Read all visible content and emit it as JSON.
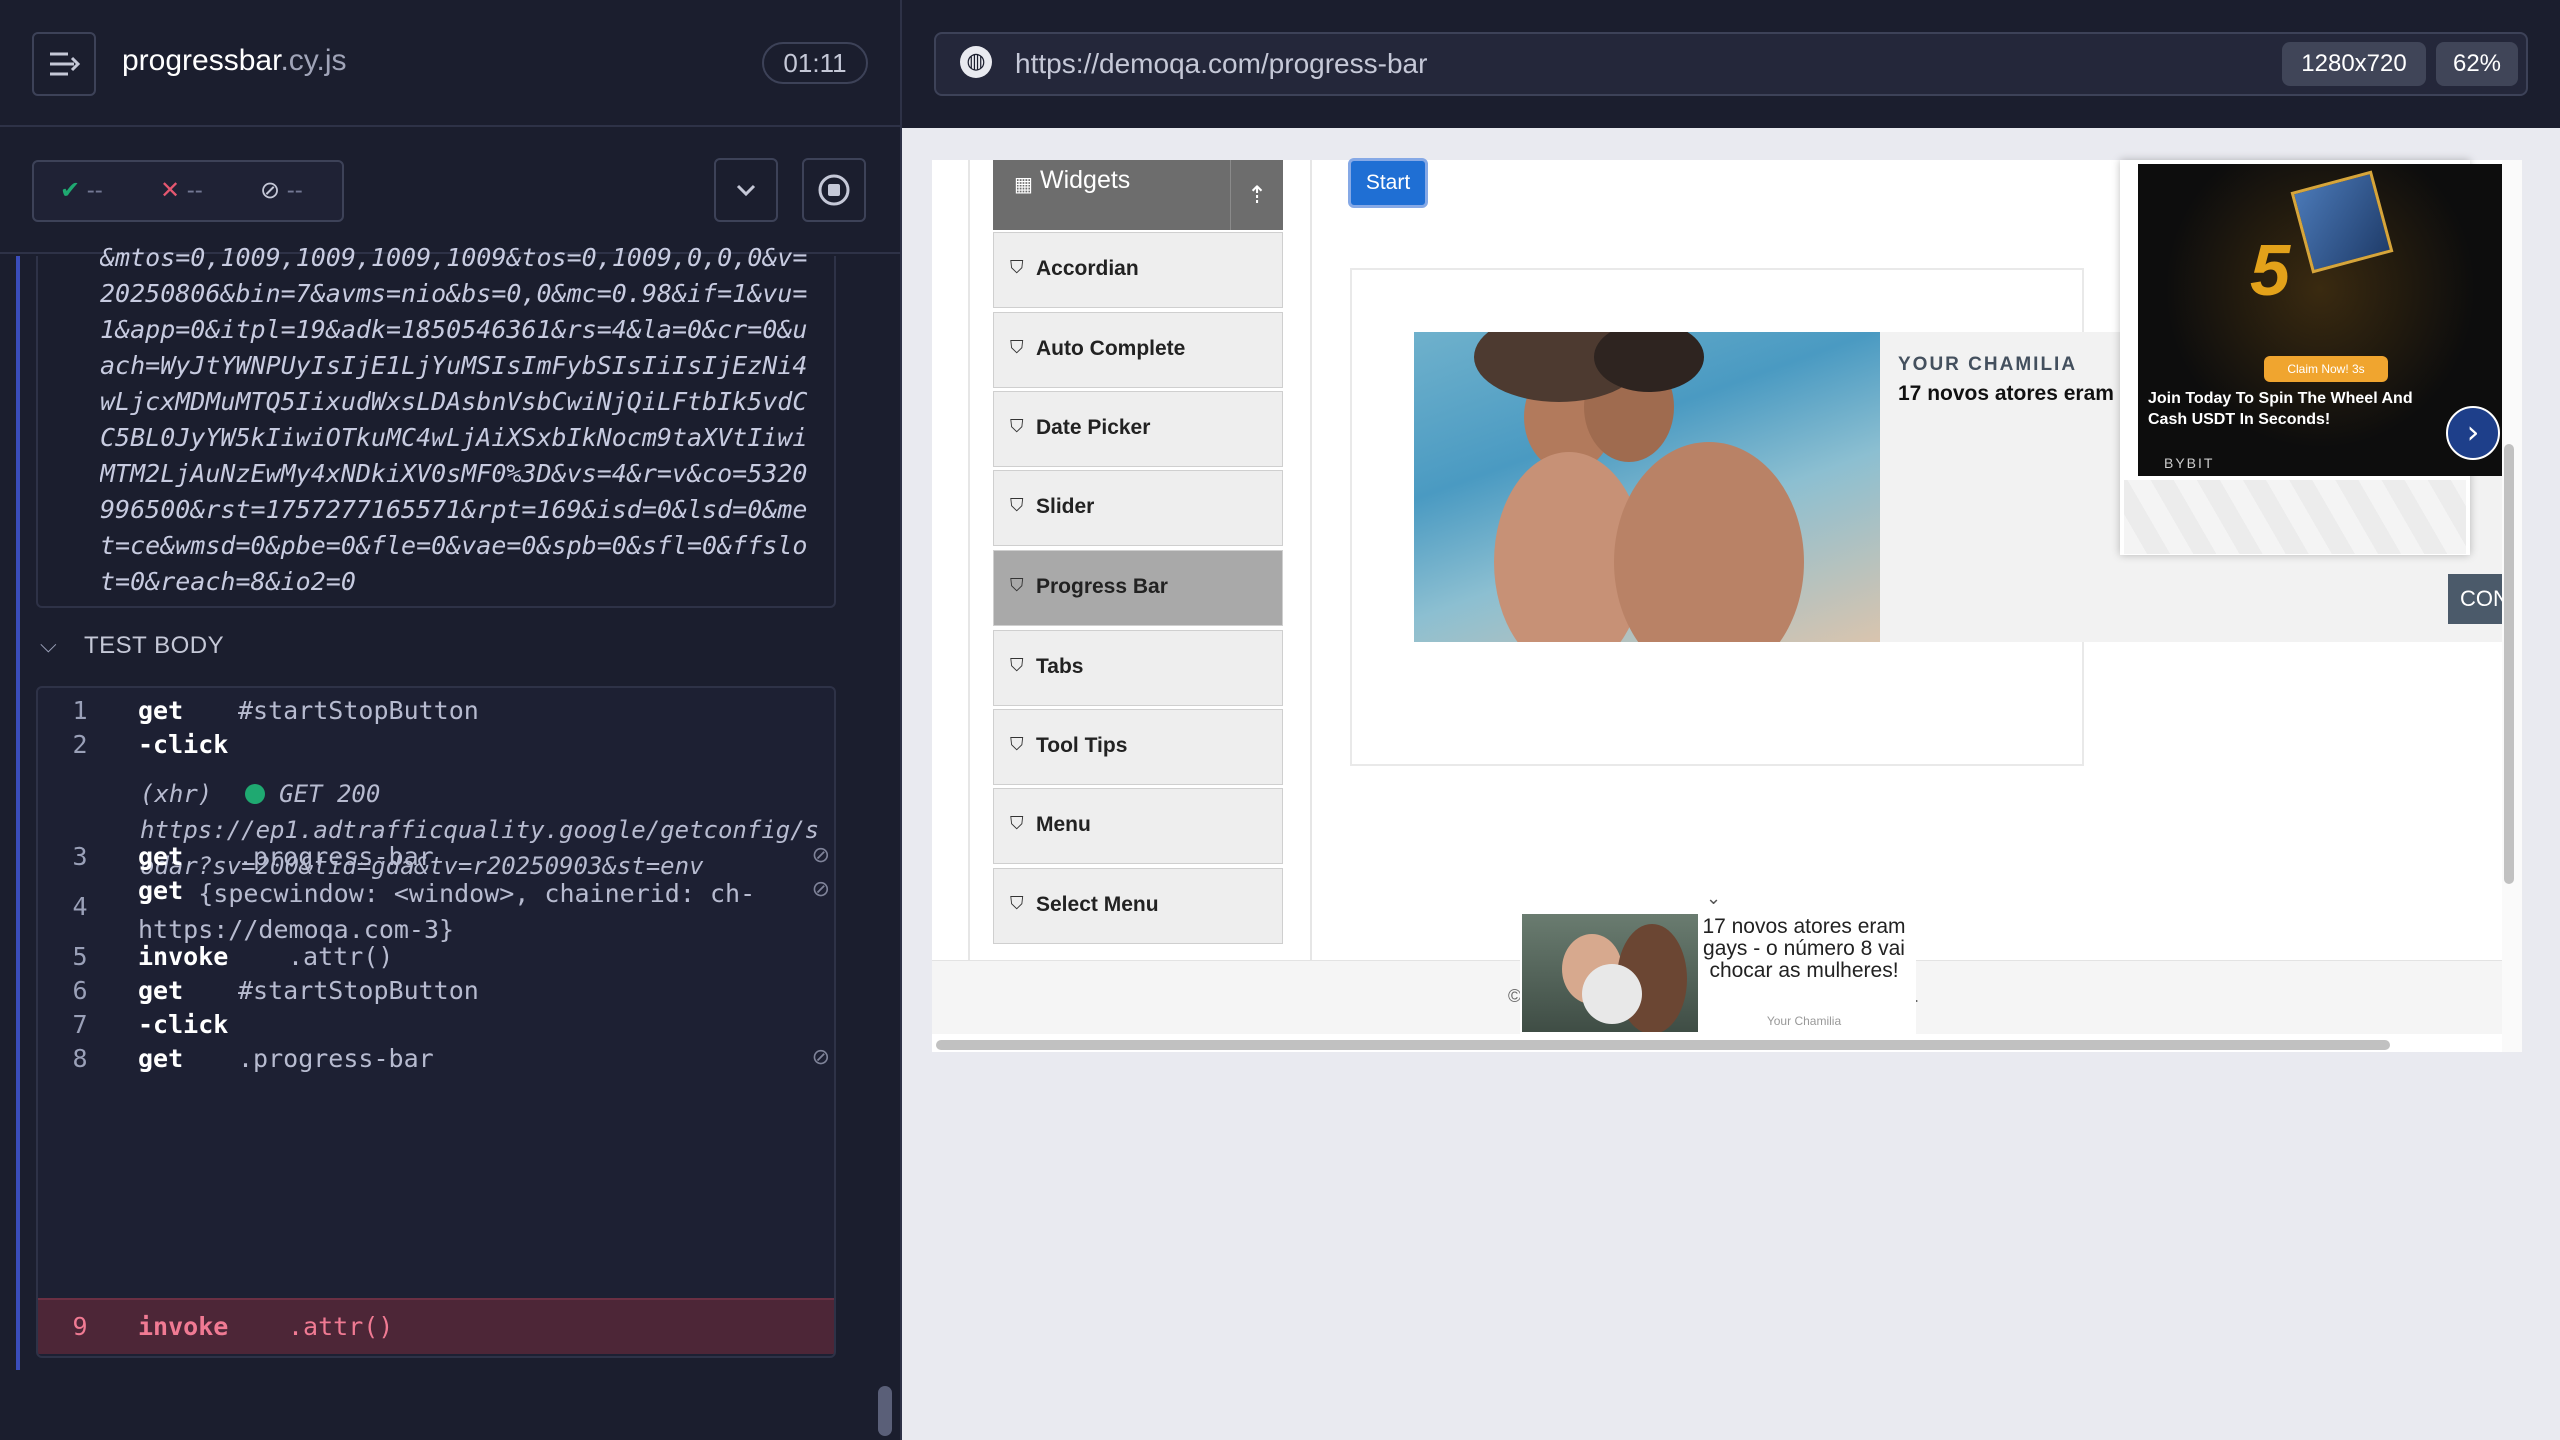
{
  "runner": {
    "spec_name": "progressbar",
    "spec_ext": ".cy.js",
    "timer": "01:11",
    "passed": "--",
    "failed": "--",
    "pending": "--",
    "url_text": "&mtos=0,1009,1009,1009,1009&tos=0,1009,0,0,0&v=20250806&bin=7&avms=nio&bs=0,0&mc=0.98&if=1&vu=1&app=0&itpl=19&adk=1850546361&rs=4&la=0&cr=0&uach=WyJtYWNPUyIsIjE1LjYuMSIsImFybSIsIiIsIjEzNi4wLjcxMDMuMTQ5IixudWxsLDAsbnVsbCwiNjQiLFtbIk5vdCC5BL0JyYW5kIiwiOTkuMC4wLjAiXSxbIkNocm9taXVtIiwiMTM2LjAuNzEwMy4xNDkiXV0sMF0%3D&vs=4&r=v&co=5320996500&rst=1757277165571&rpt=169&isd=0&lsd=0&met=ce&wmsd=0&pbe=0&fle=0&vae=0&spb=0&sfl=0&ffslot=0&reach=8&io2=0",
    "test_body_label": "TEST BODY",
    "commands": [
      {
        "num": "1",
        "name": "get",
        "arg": "#startStopButton"
      },
      {
        "num": "2",
        "name": "-click",
        "arg": ""
      },
      {
        "num": "3",
        "name": "get",
        "arg": ".progress-bar"
      },
      {
        "num": "4",
        "name": "get",
        "arg": "{specwindow: <window>, chainerid: ch-\nhttps://demoqa.com-3}"
      },
      {
        "num": "5",
        "name": "invoke",
        "arg": ".attr()"
      },
      {
        "num": "6",
        "name": "get",
        "arg": "#startStopButton"
      },
      {
        "num": "7",
        "name": "-click",
        "arg": ""
      },
      {
        "num": "8",
        "name": "get",
        "arg": ".progress-bar"
      },
      {
        "num": "9",
        "name": "invoke",
        "arg": ".attr()"
      }
    ],
    "xhr": {
      "prefix": "(xhr)",
      "method": "GET 200",
      "url": "https://ep1.adtrafficquality.google/getconfig/sodar?sv=200&tid=gda&tv=r20250903&st=env"
    }
  },
  "browser": {
    "url": "https://demoqa.com/progress-bar",
    "viewport": "1280x720",
    "zoom": "62%"
  },
  "app": {
    "group_label": "Widgets",
    "sidebar_items": [
      "Accordian",
      "Auto Complete",
      "Date Picker",
      "Slider",
      "Progress Bar",
      "Tabs",
      "Tool Tips",
      "Menu",
      "Select Menu"
    ],
    "start_label": "Start"
  },
  "ads": {
    "brand": "YOUR CHAMILIA",
    "headline": "17 novos atores eram",
    "bybit_claim": "Claim Now! 3s",
    "bybit_text": "Join Today To Spin The Wheel And Cash USDT In Seconds!",
    "bybit_name": "BYBIT",
    "bybit_number": "5",
    "con_label": "CON",
    "small_ad_text": "17 novos atores eram gays - o número 8 vai chocar as mulheres!",
    "small_ad_src": "Your Chamilia"
  },
  "footer": {
    "left": "©",
    "right": "."
  },
  "colors": {
    "runner_bg": "#1b1e2e",
    "pass": "#1fa971",
    "fail": "#e45770",
    "active_row": "#4d2637",
    "start_button": "#1f6fd4"
  }
}
